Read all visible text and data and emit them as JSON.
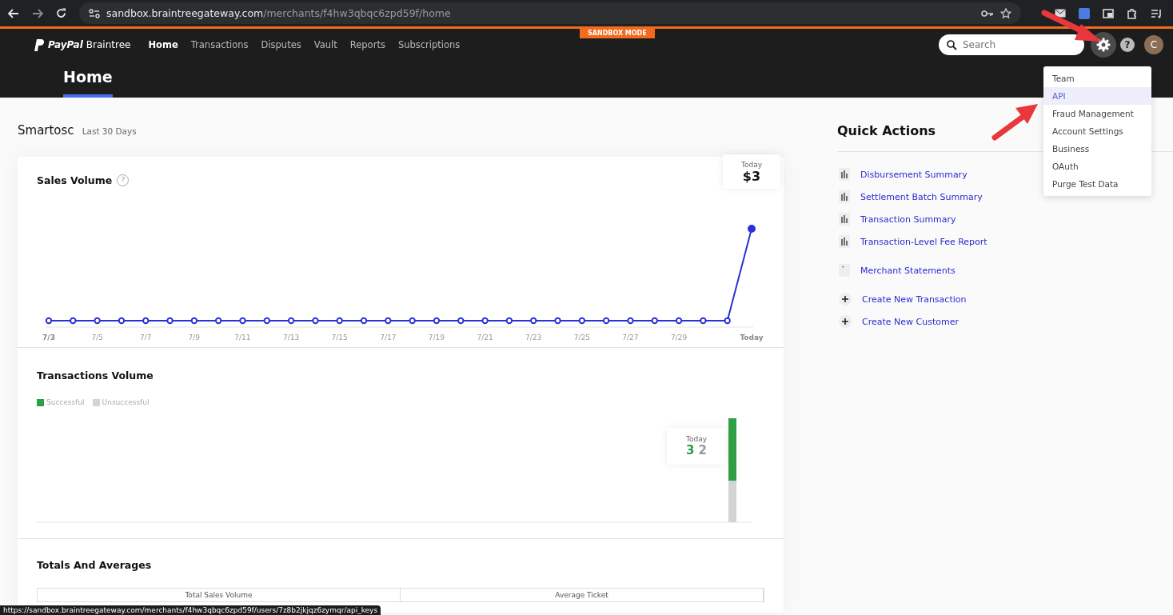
{
  "browser": {
    "url_host": "sandbox.braintreegateway.com",
    "url_path": "/merchants/f4hw3qbqc6zpd59f/home",
    "status_url": "https://sandbox.braintreegateway.com/merchants/f4hw3qbqc6zpd59f/users/7z8b2jkjqz6zymqr/api_keys"
  },
  "sandbox_label": "SANDBOX MODE",
  "brand": {
    "name_bold": "PayPal",
    "name": "Braintree"
  },
  "nav_tabs": [
    {
      "label": "Home",
      "selected": true
    },
    {
      "label": "Transactions",
      "selected": false
    },
    {
      "label": "Disputes",
      "selected": false
    },
    {
      "label": "Vault",
      "selected": false
    },
    {
      "label": "Reports",
      "selected": false
    },
    {
      "label": "Subscriptions",
      "selected": false
    }
  ],
  "search": {
    "placeholder": "Search"
  },
  "help_label": "?",
  "avatar": "C",
  "page_title": "Home",
  "settings_menu": [
    {
      "label": "Team",
      "selected": false
    },
    {
      "label": "API",
      "selected": true
    },
    {
      "label": "Fraud Management",
      "selected": false
    },
    {
      "label": "Account Settings",
      "selected": false
    },
    {
      "label": "Business",
      "selected": false
    },
    {
      "label": "OAuth",
      "selected": false
    },
    {
      "label": "Purge Test Data",
      "selected": false
    }
  ],
  "merchant": {
    "name": "Smartosc",
    "period": "Last 30 Days"
  },
  "sales_volume": {
    "title": "Sales Volume",
    "help_label": "?",
    "tooltip_label": "Today",
    "tooltip_value": "$3",
    "x_labels": [
      "7/3",
      "7/5",
      "7/7",
      "7/9",
      "7/11",
      "7/13",
      "7/15",
      "7/17",
      "7/19",
      "7/21",
      "7/23",
      "7/25",
      "7/27",
      "7/29",
      "Today"
    ]
  },
  "transactions_volume": {
    "title": "Transactions Volume",
    "legend": [
      {
        "label": "Successful",
        "color": "#2ea043"
      },
      {
        "label": "Unsuccessful",
        "color": "#d4d4d4"
      }
    ],
    "tooltip_label": "Today",
    "tooltip_values": [
      "3",
      "2"
    ]
  },
  "totals": {
    "title": "Totals And Averages",
    "columns": [
      "Total Sales Volume",
      "Average Ticket"
    ]
  },
  "quick_actions": {
    "title": "Quick Actions",
    "items": [
      {
        "kind": "report",
        "label": "Disbursement Summary"
      },
      {
        "kind": "report",
        "label": "Settlement Batch Summary"
      },
      {
        "kind": "report",
        "label": "Transaction Summary"
      },
      {
        "kind": "report",
        "label": "Transaction-Level Fee Report"
      },
      {
        "kind": "statement",
        "label": "Merchant Statements"
      },
      {
        "kind": "create",
        "label": "Create New Transaction"
      },
      {
        "kind": "create",
        "label": "Create New Customer"
      }
    ]
  }
}
